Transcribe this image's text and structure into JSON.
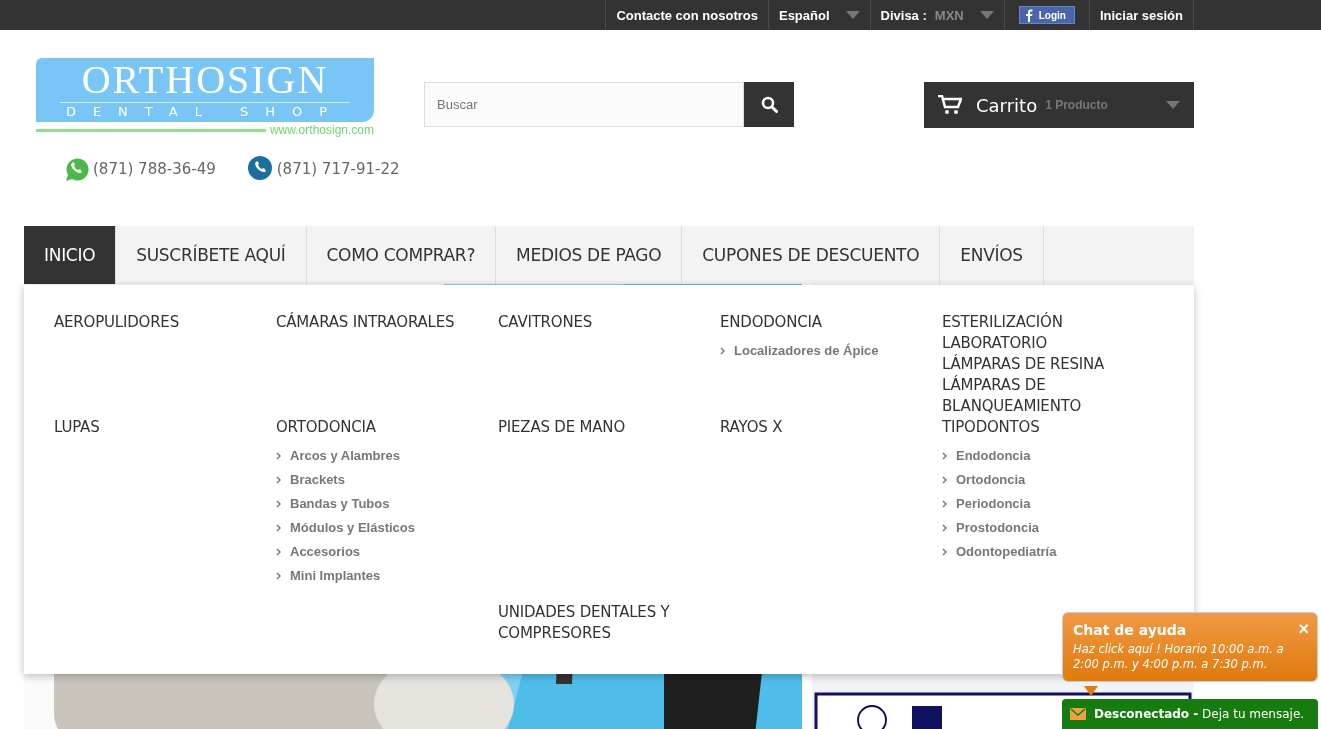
{
  "top_bar": {
    "contact": "Contacte con nosotros",
    "language": "Español",
    "currency_label": "Divisa :",
    "currency": "MXN",
    "facebook_login": "Login",
    "sign_in": "Iniciar sesión"
  },
  "logo": {
    "name": "ORTHOSIGN",
    "tagline": "DENTAL SHOP",
    "url": "www.orthosign.com"
  },
  "phones": [
    {
      "kind": "whatsapp",
      "number": "(871) 788-36-49"
    },
    {
      "kind": "phone",
      "number": "(871) 717-91-22"
    }
  ],
  "search": {
    "placeholder": "Buscar"
  },
  "cart": {
    "label": "Carrito",
    "count": "1 Producto"
  },
  "nav": [
    {
      "label": "INICIO",
      "selected": true
    },
    {
      "label": "SUSCRÍBETE AQUÍ",
      "selected": false
    },
    {
      "label": "COMO COMPRAR?",
      "selected": false
    },
    {
      "label": "MEDIOS DE PAGO",
      "selected": false
    },
    {
      "label": "CUPONES DE DESCUENTO",
      "selected": false
    },
    {
      "label": "ENVÍOS",
      "selected": false
    }
  ],
  "menu_columns": [
    [
      [
        {
          "title": "AEROPULIDORES"
        }
      ],
      [
        {
          "title": "LUPAS"
        }
      ]
    ],
    [
      [
        {
          "title": "CÁMARAS INTRAORALES"
        }
      ],
      [
        {
          "title": "ORTODONCIA",
          "children": [
            "Arcos y Alambres",
            "Brackets",
            "Bandas y Tubos",
            "Módulos y Elásticos",
            "Accesorios",
            "Mini Implantes"
          ]
        }
      ]
    ],
    [
      [
        {
          "title": "CAVITRONES"
        }
      ],
      [
        {
          "title": "PIEZAS DE MANO"
        }
      ],
      [
        {
          "title": "UNIDADES DENTALES Y COMPRESORES"
        }
      ]
    ],
    [
      [
        {
          "title": "ENDODONCIA",
          "children": [
            "Localizadores de Ápice"
          ]
        }
      ],
      [
        {
          "title": "RAYOS X"
        }
      ]
    ],
    [
      [
        {
          "title": "ESTERILIZACIÓN"
        },
        {
          "title": "LABORATORIO"
        },
        {
          "title": "LÁMPARAS DE RESINA"
        },
        {
          "title": "LÁMPARAS DE BLANQUEAMIENTO"
        },
        {
          "title": "TIPODONTOS",
          "children": [
            "Endodoncia",
            "Ortodoncia",
            "Periodoncia",
            "Prostodoncia",
            "Odontopediatría"
          ]
        }
      ]
    ]
  ],
  "chat": {
    "title": "Chat de ayuda",
    "close": "×",
    "message": "Haz click aquí ! Horario 10:00 a.m. a 2:00 p.m. y 4:00 p.m. a 7:30 p.m.",
    "status": "**Desconectado -** Deja tu mensaje."
  }
}
